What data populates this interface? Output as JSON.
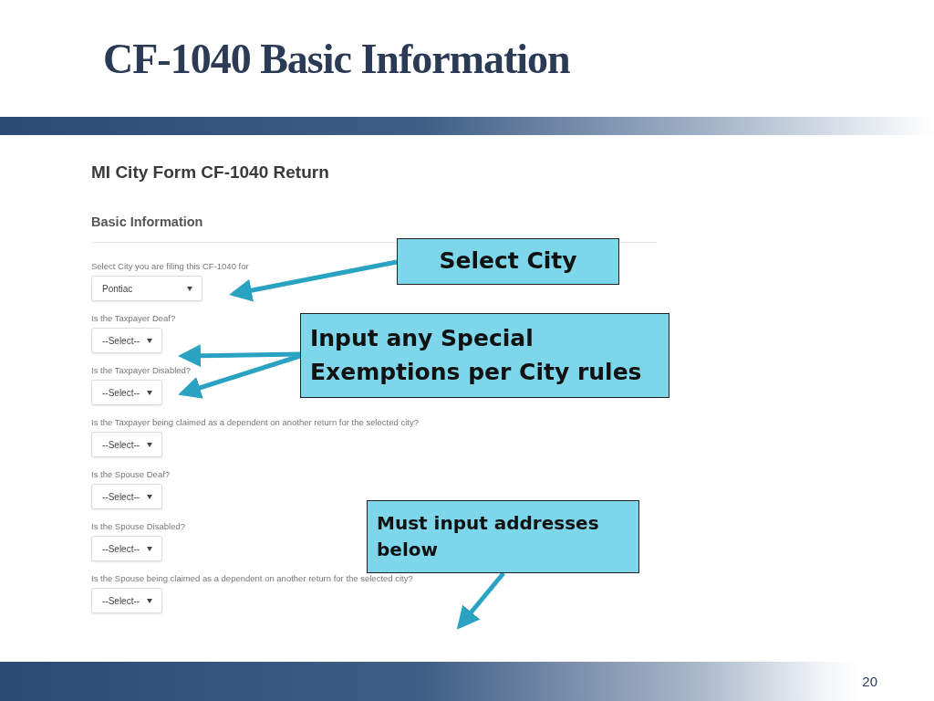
{
  "slide": {
    "title": "CF-1040 Basic Information",
    "page_number": "20"
  },
  "form": {
    "title": "MI City Form CF-1040 Return",
    "section": "Basic Information",
    "fields": [
      {
        "label": "Select City you are filing this CF-1040 for",
        "value": "Pontiac",
        "kind": "wide"
      },
      {
        "label": "Is the Taxpayer Deaf?",
        "value": "--Select--",
        "kind": "narrow"
      },
      {
        "label": "Is the Taxpayer Disabled?",
        "value": "--Select--",
        "kind": "narrow"
      },
      {
        "label": "Is the Taxpayer being claimed as a dependent on another return for the selected city?",
        "value": "--Select--",
        "kind": "narrow"
      },
      {
        "label": "Is the Spouse Deaf?",
        "value": "--Select--",
        "kind": "narrow"
      },
      {
        "label": "Is the Spouse Disabled?",
        "value": "--Select--",
        "kind": "narrow"
      },
      {
        "label": "Is the Spouse being claimed as a dependent on another return for the selected city?",
        "value": "--Select--",
        "kind": "narrow"
      }
    ]
  },
  "callouts": [
    {
      "text": "Select City",
      "kind": "center"
    },
    {
      "text": "Input any Special Exemptions per City rules",
      "kind": "left"
    },
    {
      "text": "Must input addresses below",
      "kind": "left"
    }
  ]
}
